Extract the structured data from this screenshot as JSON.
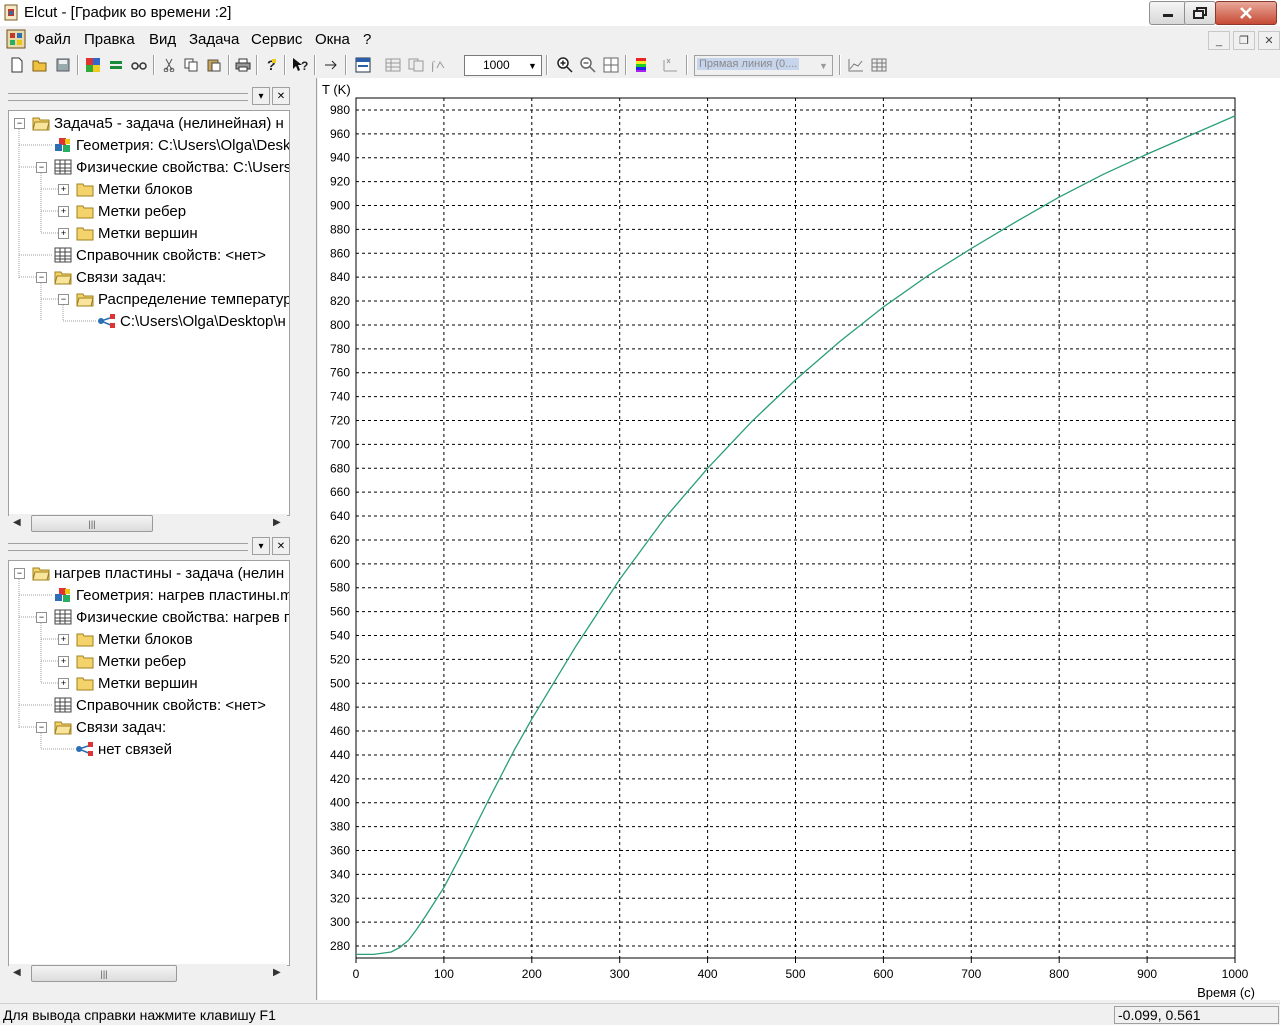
{
  "window": {
    "title": "Elcut - [График во времени :2]"
  },
  "menu": [
    "Файл",
    "Правка",
    "Вид",
    "Задача",
    "Сервис",
    "Окна",
    "?"
  ],
  "toolbar": {
    "zoom_value": "1000",
    "line_combo": "Прямая линия (0...."
  },
  "panel1": {
    "nodes": [
      {
        "label": "Задача5 -  задача (нелинейная) н",
        "icon": "folder-open-icon"
      },
      {
        "label": "Геометрия: C:\\Users\\Olga\\Desk",
        "icon": "geometry-icon"
      },
      {
        "label": "Физические свойства: C:\\Users\\",
        "icon": "table-icon"
      },
      {
        "label": "Метки блоков",
        "icon": "folder-icon"
      },
      {
        "label": "Метки ребер",
        "icon": "folder-icon"
      },
      {
        "label": "Метки вершин",
        "icon": "folder-icon"
      },
      {
        "label": "Справочник свойств: <нет>",
        "icon": "table-icon"
      },
      {
        "label": "Связи задач:",
        "icon": "folder-open-icon"
      },
      {
        "label": "Распределение температур",
        "icon": "folder-open-icon"
      },
      {
        "label": "C:\\Users\\Olga\\Desktop\\н",
        "icon": "link-icon"
      }
    ]
  },
  "panel2": {
    "nodes": [
      {
        "label": "нагрев пластины -  задача (нелин",
        "icon": "folder-open-icon"
      },
      {
        "label": "Геометрия: нагрев пластины.m",
        "icon": "geometry-icon"
      },
      {
        "label": "Физические свойства: нагрев п",
        "icon": "table-icon"
      },
      {
        "label": "Метки блоков",
        "icon": "folder-icon"
      },
      {
        "label": "Метки ребер",
        "icon": "folder-icon"
      },
      {
        "label": "Метки вершин",
        "icon": "folder-icon"
      },
      {
        "label": "Справочник свойств: <нет>",
        "icon": "table-icon"
      },
      {
        "label": "Связи задач:",
        "icon": "folder-open-icon"
      },
      {
        "label": "нет связей",
        "icon": "link-icon"
      }
    ]
  },
  "chart_data": {
    "type": "line",
    "xlabel": "Время (с)",
    "ylabel": "T (K)",
    "xlim": [
      0,
      1000
    ],
    "ylim": [
      270,
      990
    ],
    "xticks": [
      0,
      100,
      200,
      300,
      400,
      500,
      600,
      700,
      800,
      900,
      1000
    ],
    "yticks": [
      280,
      300,
      320,
      340,
      360,
      380,
      400,
      420,
      440,
      460,
      480,
      500,
      520,
      540,
      560,
      580,
      600,
      620,
      640,
      660,
      680,
      700,
      720,
      740,
      760,
      780,
      800,
      820,
      840,
      860,
      880,
      900,
      920,
      940,
      960,
      980
    ],
    "grid": true,
    "color": "#2a9d7a",
    "series": [
      {
        "x": [
          0,
          20,
          40,
          50,
          60,
          70,
          80,
          100,
          120,
          150,
          180,
          200,
          250,
          300,
          350,
          400,
          450,
          500,
          550,
          600,
          650,
          700,
          750,
          800,
          850,
          900,
          950,
          1000
        ],
        "y": [
          273,
          273,
          275,
          279,
          285,
          295,
          306,
          329,
          357,
          401,
          444,
          470,
          531,
          587,
          637,
          680,
          719,
          754,
          786,
          815,
          841,
          864,
          886,
          907,
          926,
          943,
          959,
          975
        ]
      }
    ]
  },
  "status": {
    "text": "Для вывода справки нажмите клавишу F1",
    "coords": "-0.099, 0.561"
  }
}
